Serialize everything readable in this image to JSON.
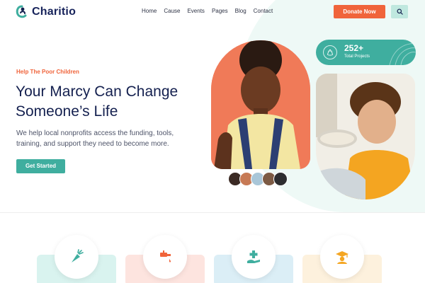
{
  "brand": {
    "name": "Charitio"
  },
  "nav": {
    "items": [
      "Home",
      "Cause",
      "Events",
      "Pages",
      "Blog",
      "Contact"
    ]
  },
  "header": {
    "donate_label": "Donate Now",
    "search_icon": "search-icon"
  },
  "hero": {
    "tagline": "Help The Poor Children",
    "headline": "Your Marcy Can Change Someone’s Life",
    "description": "We help local nonprofits access the funding, tools, training, and support they need to become more.",
    "cta_label": "Get Started"
  },
  "stats": {
    "number": "252+",
    "label": "Total Projects",
    "icon": "money-bag-icon"
  },
  "features": [
    {
      "icon": "carrot-icon",
      "card_color": "#d9f3ef",
      "icon_color": "#3fae9f"
    },
    {
      "icon": "water-tap-icon",
      "card_color": "#fde4df",
      "icon_color": "#f0643b"
    },
    {
      "icon": "medical-care-icon",
      "card_color": "#dbeef6",
      "icon_color": "#3fae9f"
    },
    {
      "icon": "graduation-icon",
      "card_color": "#fdf1dd",
      "icon_color": "#f4a521"
    }
  ],
  "colors": {
    "primary": "#f0643b",
    "secondary": "#3fae9f",
    "heading": "#14204f"
  }
}
